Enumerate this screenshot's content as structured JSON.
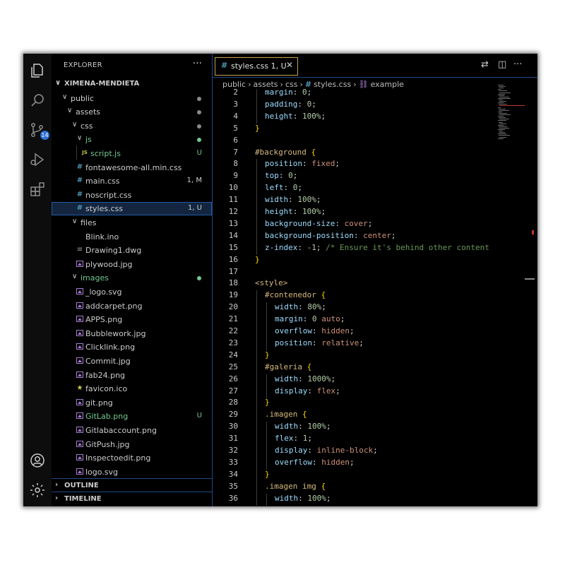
{
  "explorer": {
    "title": "EXPLORER",
    "more": "···",
    "root": "XIMENA-MENDIETA",
    "tree": [
      {
        "label": "public",
        "kind": "folder",
        "depth": 1,
        "status": "",
        "dot": "#8a8a8a",
        "color": "#cccccc"
      },
      {
        "label": "assets",
        "kind": "folder",
        "depth": 2,
        "status": "",
        "dot": "#8a8a8a",
        "color": "#cccccc"
      },
      {
        "label": "css",
        "kind": "folder",
        "depth": 3,
        "status": "",
        "dot": "#8a8a8a",
        "color": "#cccccc"
      },
      {
        "label": "js",
        "kind": "folder",
        "depth": 4,
        "status": "",
        "dot": "#73c991",
        "color": "#73c991"
      },
      {
        "label": "script.js",
        "kind": "js",
        "depth": 5,
        "status": "U",
        "dot": "",
        "color": "#73c991"
      },
      {
        "label": "fontawesome-all.min.css",
        "kind": "css",
        "depth": 4,
        "status": "",
        "dot": "",
        "color": "#cccccc"
      },
      {
        "label": "main.css",
        "kind": "css",
        "depth": 4,
        "status": "1, M",
        "dot": "",
        "color": "#cccccc"
      },
      {
        "label": "noscript.css",
        "kind": "css",
        "depth": 4,
        "status": "",
        "dot": "",
        "color": "#cccccc"
      },
      {
        "label": "styles.css",
        "kind": "css",
        "depth": 4,
        "status": "1, U",
        "dot": "",
        "color": "#cccccc",
        "selected": true
      },
      {
        "label": "files",
        "kind": "folder",
        "depth": 3,
        "status": "",
        "dot": "",
        "color": "#cccccc"
      },
      {
        "label": "Blink.ino",
        "kind": "plain",
        "depth": 4,
        "status": "",
        "dot": "",
        "color": "#cccccc"
      },
      {
        "label": "Drawing1.dwg",
        "kind": "lines",
        "depth": 4,
        "status": "",
        "dot": "",
        "color": "#cccccc"
      },
      {
        "label": "plywood.jpg",
        "kind": "image",
        "depth": 4,
        "status": "",
        "dot": "",
        "color": "#cccccc"
      },
      {
        "label": "images",
        "kind": "folder",
        "depth": 3,
        "status": "",
        "dot": "#73c991",
        "color": "#73c991"
      },
      {
        "label": "_logo.svg",
        "kind": "svg",
        "depth": 4,
        "status": "",
        "dot": "",
        "color": "#cccccc"
      },
      {
        "label": "addcarpet.png",
        "kind": "image",
        "depth": 4,
        "status": "",
        "dot": "",
        "color": "#cccccc"
      },
      {
        "label": "APPS.png",
        "kind": "image",
        "depth": 4,
        "status": "",
        "dot": "",
        "color": "#cccccc"
      },
      {
        "label": "Bubblework.jpg",
        "kind": "image",
        "depth": 4,
        "status": "",
        "dot": "",
        "color": "#cccccc"
      },
      {
        "label": "Clicklink.png",
        "kind": "image",
        "depth": 4,
        "status": "",
        "dot": "",
        "color": "#cccccc"
      },
      {
        "label": "Commit.jpg",
        "kind": "image",
        "depth": 4,
        "status": "",
        "dot": "",
        "color": "#cccccc"
      },
      {
        "label": "fab24.png",
        "kind": "image",
        "depth": 4,
        "status": "",
        "dot": "",
        "color": "#cccccc"
      },
      {
        "label": "favicon.ico",
        "kind": "star",
        "depth": 4,
        "status": "",
        "dot": "",
        "color": "#cccccc"
      },
      {
        "label": "git.png",
        "kind": "image",
        "depth": 4,
        "status": "",
        "dot": "",
        "color": "#cccccc"
      },
      {
        "label": "GitLab.png",
        "kind": "image",
        "depth": 4,
        "status": "U",
        "dot": "",
        "color": "#73c991"
      },
      {
        "label": "Gitlabaccount.png",
        "kind": "image",
        "depth": 4,
        "status": "",
        "dot": "",
        "color": "#cccccc"
      },
      {
        "label": "GitPush.jpg",
        "kind": "image",
        "depth": 4,
        "status": "",
        "dot": "",
        "color": "#cccccc"
      },
      {
        "label": "Inspectoedit.png",
        "kind": "image",
        "depth": 4,
        "status": "",
        "dot": "",
        "color": "#cccccc"
      },
      {
        "label": "logo.svg",
        "kind": "svg",
        "depth": 4,
        "status": "",
        "dot": "",
        "color": "#cccccc"
      }
    ],
    "outline": "OUTLINE",
    "timeline": "TIMELINE"
  },
  "activity": {
    "source_control_badge": "14"
  },
  "editor": {
    "tab": {
      "icon": "#",
      "name": "styles.css",
      "status": "1, U",
      "close": "✕"
    },
    "breadcrumb": [
      "public",
      "assets",
      "css",
      "styles.css",
      "example"
    ],
    "breadcrumb_sep": "›",
    "lines": [
      {
        "n": "2",
        "indent": 1,
        "tokens": [
          [
            "margin",
            "prop"
          ],
          [
            ": ",
            "p"
          ],
          [
            "0",
            "num"
          ],
          [
            ";",
            "p"
          ]
        ]
      },
      {
        "n": "3",
        "indent": 1,
        "tokens": [
          [
            "padding",
            "prop"
          ],
          [
            ": ",
            "p"
          ],
          [
            "0",
            "num"
          ],
          [
            ";",
            "p"
          ]
        ]
      },
      {
        "n": "4",
        "indent": 1,
        "tokens": [
          [
            "height",
            "prop"
          ],
          [
            ": ",
            "p"
          ],
          [
            "100%",
            "num"
          ],
          [
            ";",
            "p"
          ]
        ]
      },
      {
        "n": "5",
        "indent": 0,
        "tokens": [
          [
            "}",
            "brace"
          ]
        ]
      },
      {
        "n": "6",
        "indent": 0,
        "tokens": []
      },
      {
        "n": "7",
        "indent": 0,
        "tokens": [
          [
            "#background",
            "sel"
          ],
          [
            " ",
            "p"
          ],
          [
            "{",
            "brace"
          ]
        ]
      },
      {
        "n": "8",
        "indent": 1,
        "tokens": [
          [
            "position",
            "prop"
          ],
          [
            ": ",
            "p"
          ],
          [
            "fixed",
            "val"
          ],
          [
            ";",
            "p"
          ]
        ]
      },
      {
        "n": "9",
        "indent": 1,
        "tokens": [
          [
            "top",
            "prop"
          ],
          [
            ": ",
            "p"
          ],
          [
            "0",
            "num"
          ],
          [
            ";",
            "p"
          ]
        ]
      },
      {
        "n": "10",
        "indent": 1,
        "tokens": [
          [
            "left",
            "prop"
          ],
          [
            ": ",
            "p"
          ],
          [
            "0",
            "num"
          ],
          [
            ";",
            "p"
          ]
        ]
      },
      {
        "n": "11",
        "indent": 1,
        "tokens": [
          [
            "width",
            "prop"
          ],
          [
            ": ",
            "p"
          ],
          [
            "100%",
            "num"
          ],
          [
            ";",
            "p"
          ]
        ]
      },
      {
        "n": "12",
        "indent": 1,
        "tokens": [
          [
            "height",
            "prop"
          ],
          [
            ": ",
            "p"
          ],
          [
            "100%",
            "num"
          ],
          [
            ";",
            "p"
          ]
        ]
      },
      {
        "n": "13",
        "indent": 1,
        "tokens": [
          [
            "background-size",
            "prop"
          ],
          [
            ": ",
            "p"
          ],
          [
            "cover",
            "val"
          ],
          [
            ";",
            "p"
          ]
        ]
      },
      {
        "n": "14",
        "indent": 1,
        "tokens": [
          [
            "background-position",
            "prop"
          ],
          [
            ": ",
            "p"
          ],
          [
            "center",
            "val"
          ],
          [
            ";",
            "p"
          ]
        ]
      },
      {
        "n": "15",
        "indent": 1,
        "tokens": [
          [
            "z-index",
            "prop"
          ],
          [
            ": ",
            "p"
          ],
          [
            "-1",
            "num"
          ],
          [
            "; ",
            "p"
          ],
          [
            "/* Ensure it's behind other content",
            "com"
          ]
        ]
      },
      {
        "n": "16",
        "indent": 0,
        "tokens": [
          [
            "}",
            "brace"
          ]
        ]
      },
      {
        "n": "17",
        "indent": 0,
        "tokens": []
      },
      {
        "n": "18",
        "indent": 0,
        "tokens": [
          [
            "<style>",
            "tag"
          ]
        ]
      },
      {
        "n": "19",
        "indent": 1,
        "tokens": [
          [
            "#contenedor",
            "sel"
          ],
          [
            " ",
            "p"
          ],
          [
            "{",
            "brace"
          ]
        ]
      },
      {
        "n": "20",
        "indent": 2,
        "tokens": [
          [
            "width",
            "prop"
          ],
          [
            ": ",
            "p"
          ],
          [
            "80%",
            "num"
          ],
          [
            ";",
            "p"
          ]
        ]
      },
      {
        "n": "21",
        "indent": 2,
        "tokens": [
          [
            "margin",
            "prop"
          ],
          [
            ": ",
            "p"
          ],
          [
            "0",
            "num"
          ],
          [
            " ",
            "p"
          ],
          [
            "auto",
            "val"
          ],
          [
            ";",
            "p"
          ]
        ]
      },
      {
        "n": "22",
        "indent": 2,
        "tokens": [
          [
            "overflow",
            "prop"
          ],
          [
            ": ",
            "p"
          ],
          [
            "hidden",
            "val"
          ],
          [
            ";",
            "p"
          ]
        ]
      },
      {
        "n": "23",
        "indent": 2,
        "tokens": [
          [
            "position",
            "prop"
          ],
          [
            ": ",
            "p"
          ],
          [
            "relative",
            "val"
          ],
          [
            ";",
            "p"
          ]
        ]
      },
      {
        "n": "24",
        "indent": 1,
        "tokens": [
          [
            "}",
            "brace"
          ]
        ]
      },
      {
        "n": "25",
        "indent": 1,
        "tokens": [
          [
            "#galeria",
            "sel"
          ],
          [
            " ",
            "p"
          ],
          [
            "{",
            "brace"
          ]
        ]
      },
      {
        "n": "26",
        "indent": 2,
        "tokens": [
          [
            "width",
            "prop"
          ],
          [
            ": ",
            "p"
          ],
          [
            "1000%",
            "num"
          ],
          [
            ";",
            "p"
          ]
        ]
      },
      {
        "n": "27",
        "indent": 2,
        "tokens": [
          [
            "display",
            "prop"
          ],
          [
            ": ",
            "p"
          ],
          [
            "flex",
            "val"
          ],
          [
            ";",
            "p"
          ]
        ]
      },
      {
        "n": "28",
        "indent": 1,
        "tokens": [
          [
            "}",
            "brace"
          ]
        ]
      },
      {
        "n": "29",
        "indent": 1,
        "tokens": [
          [
            ".imagen",
            "cls"
          ],
          [
            " ",
            "p"
          ],
          [
            "{",
            "brace"
          ]
        ]
      },
      {
        "n": "30",
        "indent": 2,
        "tokens": [
          [
            "width",
            "prop"
          ],
          [
            ": ",
            "p"
          ],
          [
            "100%",
            "num"
          ],
          [
            ";",
            "p"
          ]
        ]
      },
      {
        "n": "31",
        "indent": 2,
        "tokens": [
          [
            "flex",
            "prop"
          ],
          [
            ": ",
            "p"
          ],
          [
            "1",
            "num"
          ],
          [
            ";",
            "p"
          ]
        ]
      },
      {
        "n": "32",
        "indent": 2,
        "tokens": [
          [
            "display",
            "prop"
          ],
          [
            ": ",
            "p"
          ],
          [
            "inline-block",
            "val"
          ],
          [
            ";",
            "p"
          ]
        ]
      },
      {
        "n": "33",
        "indent": 2,
        "tokens": [
          [
            "overflow",
            "prop"
          ],
          [
            ": ",
            "p"
          ],
          [
            "hidden",
            "val"
          ],
          [
            ";",
            "p"
          ]
        ]
      },
      {
        "n": "34",
        "indent": 1,
        "tokens": [
          [
            "}",
            "brace"
          ]
        ]
      },
      {
        "n": "35",
        "indent": 1,
        "tokens": [
          [
            ".imagen img",
            "cls"
          ],
          [
            " ",
            "p"
          ],
          [
            "{",
            "brace"
          ]
        ]
      },
      {
        "n": "36",
        "indent": 2,
        "tokens": [
          [
            "width",
            "prop"
          ],
          [
            ": ",
            "p"
          ],
          [
            "100%",
            "num"
          ],
          [
            ";",
            "p"
          ]
        ]
      }
    ]
  },
  "colors": {
    "prop": "#9cdcfe",
    "num": "#b5cea8",
    "val": "#ce9178",
    "sel": "#d7ba7d",
    "cls": "#d7ba7d",
    "brace": "#ffd700",
    "p": "#d4d4d4",
    "com": "#6a9955",
    "tag": "#d7ba7d",
    "accent": "#2058a7",
    "untracked": "#73c991"
  }
}
